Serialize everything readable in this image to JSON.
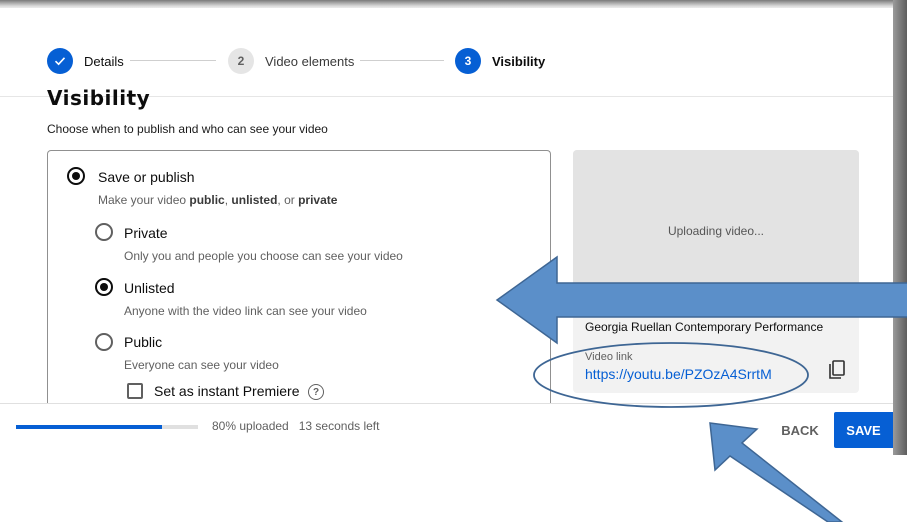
{
  "stepper": {
    "steps": [
      {
        "number": "1",
        "label": "Details",
        "state": "done"
      },
      {
        "number": "2",
        "label": "Video elements",
        "state": "todo"
      },
      {
        "number": "3",
        "label": "Visibility",
        "state": "current"
      }
    ]
  },
  "visibility": {
    "title": "Visibility",
    "subtitle": "Choose when to publish and who can see your video",
    "save_or_publish": {
      "label": "Save or publish",
      "desc_prefix": "Make your video ",
      "desc_public": "public",
      "desc_sep1": ", ",
      "desc_unlisted": "unlisted",
      "desc_sep2": ", or ",
      "desc_private": "private",
      "selected": true
    },
    "options": [
      {
        "label": "Private",
        "desc": "Only you and people you choose can see your video",
        "selected": false
      },
      {
        "label": "Unlisted",
        "desc": "Anyone with the video link can see your video",
        "selected": true
      },
      {
        "label": "Public",
        "desc": "Everyone can see your video",
        "selected": false
      }
    ],
    "premiere": {
      "label": "Set as instant Premiere",
      "checked": false,
      "help_glyph": "?"
    }
  },
  "preview": {
    "status": "Uploading video...",
    "video_title": "Georgia Ruellan Contemporary Performance",
    "link_label": "Video link",
    "link": "https://youtu.be/PZOzA4SrrtM",
    "copy_icon": "copy-icon"
  },
  "footer": {
    "progress_fraction": 0.8,
    "progress_text": "80% uploaded",
    "time_left": "13 seconds left",
    "back_label": "BACK",
    "save_label": "SAVE"
  },
  "colors": {
    "accent": "#065fd4",
    "annotation_arrow": "#5b8fc9",
    "annotation_outline": "#3e6694"
  },
  "annotations": {
    "arrows": [
      "arrow-pointing-left",
      "arrow-pointing-up-left"
    ],
    "ellipse": "link-highlight-ellipse"
  }
}
